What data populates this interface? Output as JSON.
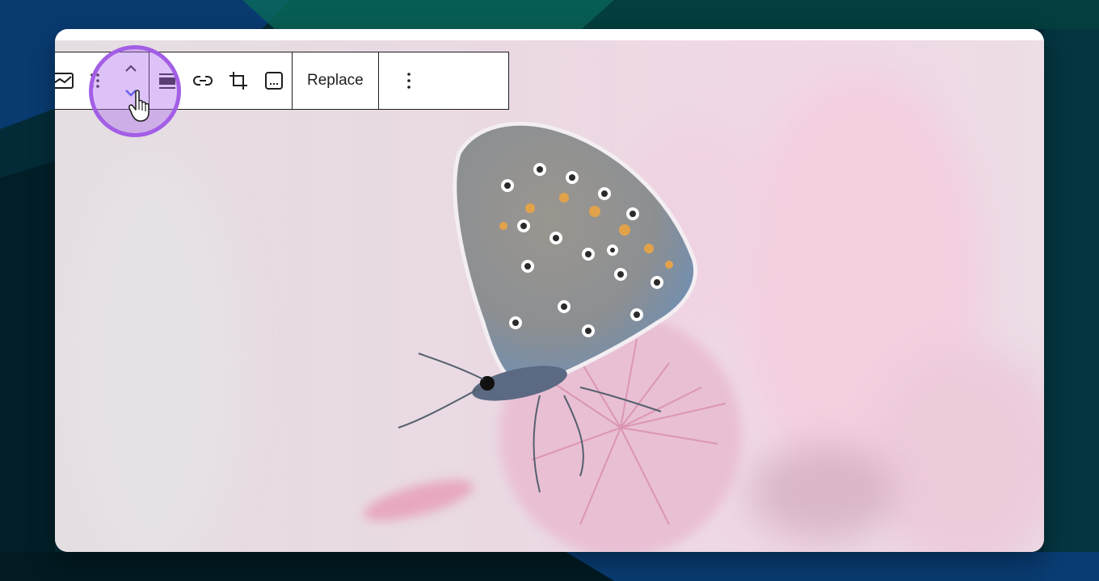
{
  "toolbar": {
    "buttons": {
      "block_type": "image-icon",
      "drag": "drag-handle-icon",
      "move_up": "chevron-up-icon",
      "move_down": "chevron-down-icon",
      "align": "align-icon",
      "link": "link-icon",
      "crop": "crop-icon",
      "caption": "caption-icon",
      "more": "more-vertical-icon"
    },
    "replace_label": "Replace"
  },
  "highlight_color": "#a35ee6",
  "accent_color": "#3858e9"
}
